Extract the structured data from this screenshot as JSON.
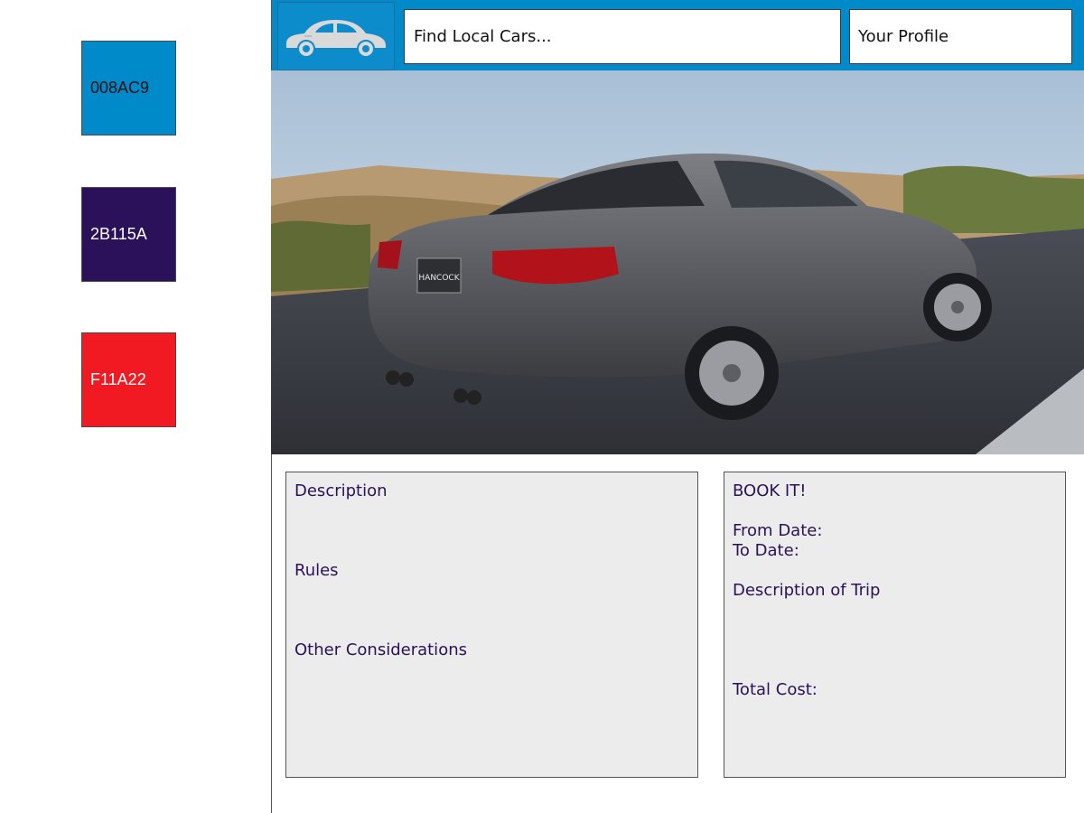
{
  "palette": {
    "swatches": [
      {
        "label": "008AC9",
        "color": "#008AC9"
      },
      {
        "label": "2B115A",
        "color": "#2B115A"
      },
      {
        "label": "F11A22",
        "color": "#F11A22"
      }
    ]
  },
  "header": {
    "logo_icon": "car-icon",
    "search_placeholder": "Find Local Cars...",
    "profile_label": "Your Profile"
  },
  "hero": {
    "image_icon": "car-photo",
    "plate_text": "HANCOCK"
  },
  "details": {
    "description": "Description",
    "rules": "Rules",
    "other": "Other Considerations"
  },
  "booking": {
    "title": "BOOK IT!",
    "from_date": "From Date:",
    "to_date": "To Date:",
    "trip_description": "Description of Trip",
    "total_cost": "Total Cost:"
  }
}
